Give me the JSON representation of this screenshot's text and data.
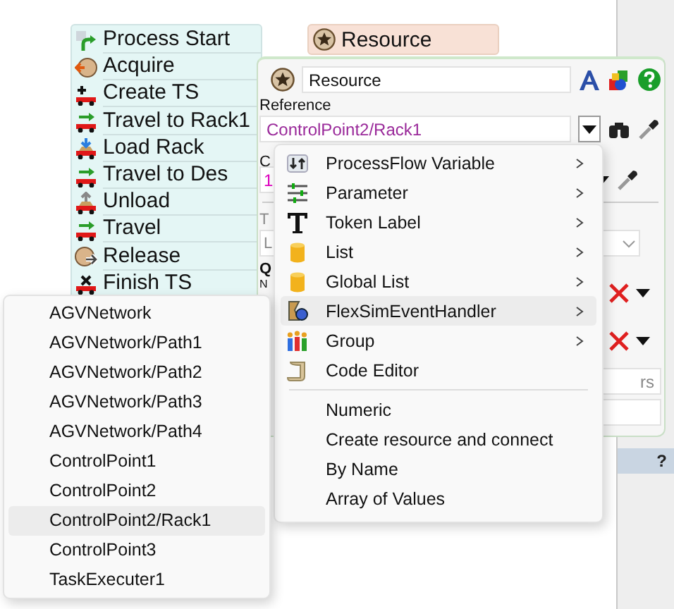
{
  "activities": [
    {
      "label": "Process Start",
      "kind": "start"
    },
    {
      "label": "Acquire",
      "kind": "acquire"
    },
    {
      "label": "Create TS",
      "kind": "create"
    },
    {
      "label": "Travel to Rack1",
      "kind": "travel"
    },
    {
      "label": "Load Rack",
      "kind": "load"
    },
    {
      "label": "Travel to Des",
      "kind": "travel"
    },
    {
      "label": "Unload",
      "kind": "unload"
    },
    {
      "label": "Travel",
      "kind": "travel"
    },
    {
      "label": "Release",
      "kind": "release"
    },
    {
      "label": "Finish TS",
      "kind": "finish"
    }
  ],
  "resource_block": {
    "label": "Resource"
  },
  "properties": {
    "name": "Resource",
    "reference_label": "Reference",
    "reference": "ControlPoint2/Rack1",
    "label_c": "C",
    "value_field": "1",
    "label_t": "T",
    "field_l": "L",
    "label_q": "Q",
    "label_n": "N",
    "field_text": "rs"
  },
  "menu": {
    "items": [
      {
        "label": "ProcessFlow Variable",
        "kind": "variable",
        "has_submenu": true,
        "selected": false
      },
      {
        "label": "Parameter",
        "kind": "parameter",
        "has_submenu": true,
        "selected": false
      },
      {
        "label": "Token Label",
        "kind": "label",
        "has_submenu": true,
        "selected": false
      },
      {
        "label": "List",
        "kind": "list",
        "has_submenu": true,
        "selected": false
      },
      {
        "label": "Global List",
        "kind": "list",
        "has_submenu": true,
        "selected": false
      },
      {
        "label": "FlexSimEventHandler",
        "kind": "handler",
        "has_submenu": true,
        "selected": true
      },
      {
        "label": "Group",
        "kind": "group",
        "has_submenu": true,
        "selected": false
      },
      {
        "label": "Code Editor",
        "kind": "code",
        "has_submenu": false,
        "selected": false
      }
    ],
    "extra_items": [
      {
        "label": "Numeric",
        "selected": false
      },
      {
        "label": "Create resource and connect",
        "selected": false
      },
      {
        "label": "By Name",
        "selected": false
      },
      {
        "label": "Array of Values",
        "selected": false
      }
    ]
  },
  "submenu": {
    "items": [
      {
        "label": "AGVNetwork",
        "selected": false
      },
      {
        "label": "AGVNetwork/Path1",
        "selected": false
      },
      {
        "label": "AGVNetwork/Path2",
        "selected": false
      },
      {
        "label": "AGVNetwork/Path3",
        "selected": false
      },
      {
        "label": "AGVNetwork/Path4",
        "selected": false
      },
      {
        "label": "ControlPoint1",
        "selected": false
      },
      {
        "label": "ControlPoint2",
        "selected": false
      },
      {
        "label": "ControlPoint2/Rack1",
        "selected": true
      },
      {
        "label": "ControlPoint3",
        "selected": false
      },
      {
        "label": "TaskExecuter1",
        "selected": false
      }
    ]
  },
  "help_bar": {
    "label": "?"
  }
}
